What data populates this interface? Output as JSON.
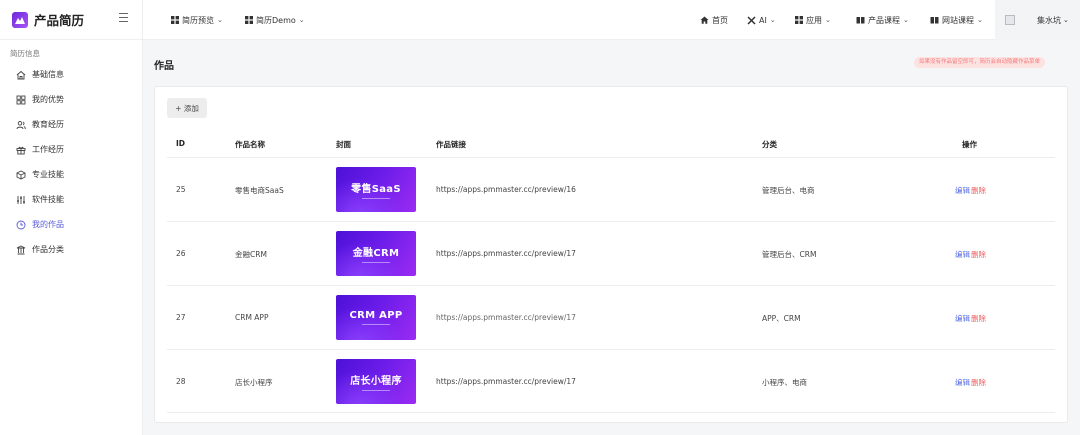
{
  "brand": {
    "title": "产品简历"
  },
  "sidebar": {
    "group_label": "简历信息",
    "items": [
      {
        "label": "基础信息",
        "icon": "home-icon"
      },
      {
        "label": "我的优势",
        "icon": "grid-icon"
      },
      {
        "label": "教育经历",
        "icon": "users-icon"
      },
      {
        "label": "工作经历",
        "icon": "gift-icon"
      },
      {
        "label": "专业技能",
        "icon": "cube-icon"
      },
      {
        "label": "软件技能",
        "icon": "sliders-icon"
      },
      {
        "label": "我的作品",
        "icon": "clock-icon",
        "active": true
      },
      {
        "label": "作品分类",
        "icon": "columns-icon"
      }
    ]
  },
  "topbar": {
    "left": [
      {
        "label": "简历预览"
      },
      {
        "label": "简历Demo"
      }
    ],
    "right": [
      {
        "label": "首页"
      },
      {
        "label": "AI"
      },
      {
        "label": "应用"
      },
      {
        "label": "产品课程"
      },
      {
        "label": "网站课程"
      }
    ],
    "user_name": "集水坑"
  },
  "page": {
    "title": "作品",
    "notice": "如果没有作品留空即可，简历会自动隐藏作品菜单"
  },
  "table": {
    "add_label": "+ 添加",
    "headers": {
      "id": "ID",
      "name": "作品名称",
      "cover": "封面",
      "link": "作品链接",
      "category": "分类",
      "actions": "操作"
    },
    "edit_label": "编辑",
    "delete_label": "删除",
    "rows": [
      {
        "id": "25",
        "name": "零售电商SaaS",
        "cover_text": "零售SaaS",
        "link": "https://apps.pmmaster.cc/preview/16",
        "category": "管理后台、电商"
      },
      {
        "id": "26",
        "name": "金融CRM",
        "cover_text": "金融CRM",
        "link": "https://apps.pmmaster.cc/preview/17",
        "category": "管理后台、CRM"
      },
      {
        "id": "27",
        "name": "CRM APP",
        "cover_text": "CRM APP",
        "link": "https://apps.pmmaster.cc/preview/17",
        "category": "APP、CRM"
      },
      {
        "id": "28",
        "name": "店长小程序",
        "cover_text": "店长小程序",
        "link": "https://apps.pmmaster.cc/preview/17",
        "category": "小程序、电商"
      }
    ]
  },
  "colors": {
    "accent": "#5b5bd6",
    "danger": "#ef5a5a",
    "cover_start": "#4c11d8",
    "cover_end": "#9b2cf3"
  }
}
